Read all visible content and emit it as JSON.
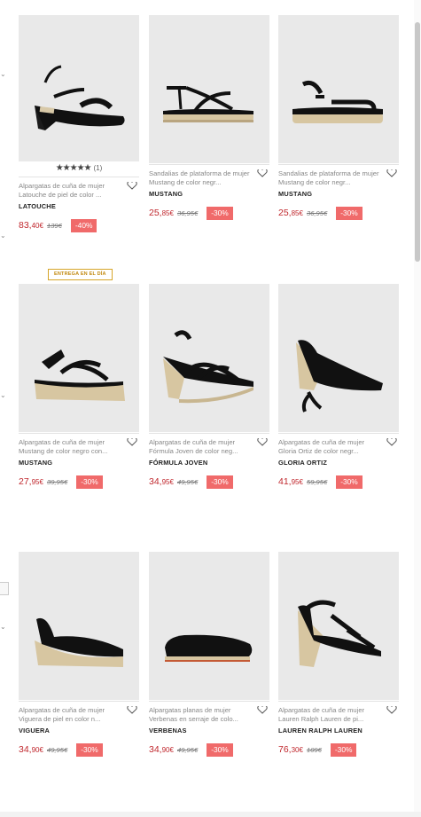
{
  "colors": {
    "accent_price": "#c0272d",
    "discount_bg": "#f06a6a",
    "badge_border": "#d6a52a",
    "image_bg": "#e9e9e9"
  },
  "products": [
    {
      "desc": "Alpargatas de cuña de mujer Latouche de piel de color ...",
      "brand": "LATOUCHE",
      "price_int": "83,",
      "price_dec": "40€",
      "old_price": "139€",
      "discount": "-40%",
      "rating_stars": "★★★★★",
      "rating_count": "(1)"
    },
    {
      "desc": "Sandalias de plataforma de mujer Mustang de color negr...",
      "brand": "MUSTANG",
      "price_int": "25,",
      "price_dec": "85€",
      "old_price": "36,95€",
      "discount": "-30%"
    },
    {
      "desc": "Sandalias de plataforma de mujer Mustang de color negr...",
      "brand": "MUSTANG",
      "price_int": "25,",
      "price_dec": "85€",
      "old_price": "36,95€",
      "discount": "-30%"
    },
    {
      "desc": "Alpargatas de cuña de mujer Mustang de color negro con...",
      "brand": "MUSTANG",
      "price_int": "27,",
      "price_dec": "95€",
      "old_price": "39,95€",
      "discount": "-30%",
      "badge": "ENTREGA EN EL DÍA"
    },
    {
      "desc": "Alpargatas de cuña de mujer Fórmula Joven de color neg...",
      "brand": "FÓRMULA JOVEN",
      "price_int": "34,",
      "price_dec": "95€",
      "old_price": "49,95€",
      "discount": "-30%"
    },
    {
      "desc": "Alpargatas de cuña de mujer Gloria Ortiz de color negr...",
      "brand": "GLORIA ORTIZ",
      "price_int": "41,",
      "price_dec": "95€",
      "old_price": "59,95€",
      "discount": "-30%"
    },
    {
      "desc": "Alpargatas de cuña de mujer Viguera de piel en color n...",
      "brand": "VIGUERA",
      "price_int": "34,",
      "price_dec": "90€",
      "old_price": "49,95€",
      "discount": "-30%"
    },
    {
      "desc": "Alpargatas planas de mujer Verbenas en serraje de colo...",
      "brand": "VERBENAS",
      "price_int": "34,",
      "price_dec": "90€",
      "old_price": "49,95€",
      "discount": "-30%"
    },
    {
      "desc": "Alpargatas de cuña de mujer Lauren Ralph Lauren de pi...",
      "brand": "LAUREN RALPH LAUREN",
      "price_int": "76,",
      "price_dec": "30€",
      "old_price": "109€",
      "discount": "-30%"
    }
  ],
  "icons": {
    "favorite": "heart-outline-icon",
    "filter_toggle": "chevron-down-icon"
  }
}
